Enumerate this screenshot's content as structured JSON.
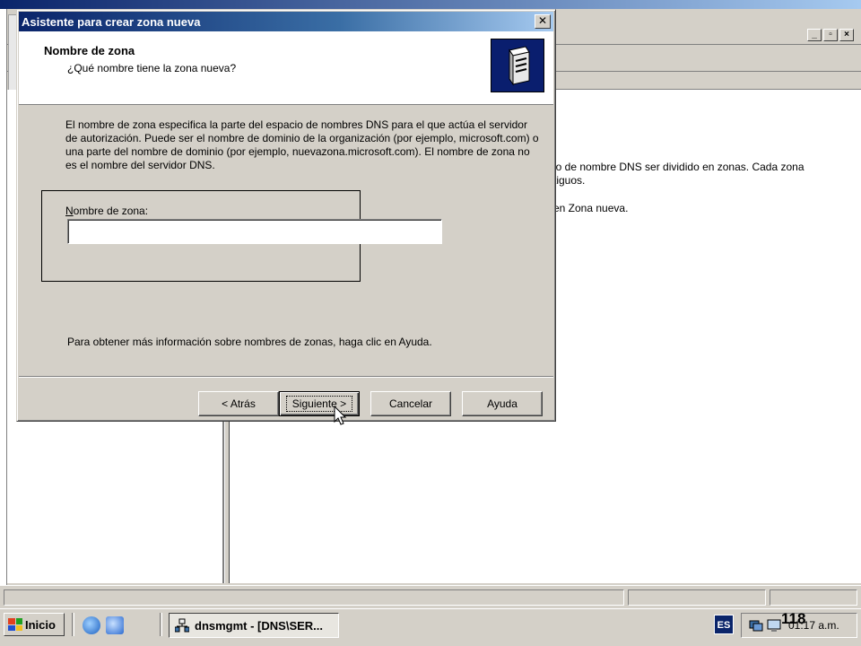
{
  "dialog": {
    "title": "Asistente para crear zona nueva",
    "close_glyph": "✕",
    "header_title": "Nombre de zona",
    "header_subtitle": "¿Qué nombre tiene la zona  nueva?",
    "description": "El nombre de zona especifica la parte del espacio de nombres DNS para el que actúa el servidor de autorización. Puede ser el nombre de dominio de la organización (por ejemplo, microsoft.com) o una parte del nombre de dominio (por ejemplo, nuevazona.microsoft.com). El nombre de zona no es el nombre del servidor DNS.",
    "zone_label_access": "N",
    "zone_label_rest": "ombre de zona:",
    "zone_value": "",
    "help_text": "Para obtener más información sobre nombres de zonas, haga clic en Ayuda.",
    "buttons": {
      "back": "< Atrás",
      "next": "Siguiente >",
      "cancel": "Cancelar",
      "help": "Ayuda"
    }
  },
  "background": {
    "content_line1": "io de nombre DNS ser dividido en zonas. Cada zona",
    "content_line2": "tiguos.",
    "content_line3": "en Zona nueva."
  },
  "taskbar": {
    "start_label": "Inicio",
    "task_label": "dnsmgmt - [DNS\\SER...",
    "language": "ES",
    "clock": "01:17 a.m."
  },
  "page_number": "118",
  "colors": {
    "titlebar_start": "#0a246a",
    "titlebar_end": "#a6caf0",
    "dialog_face": "#d4d0c8"
  }
}
